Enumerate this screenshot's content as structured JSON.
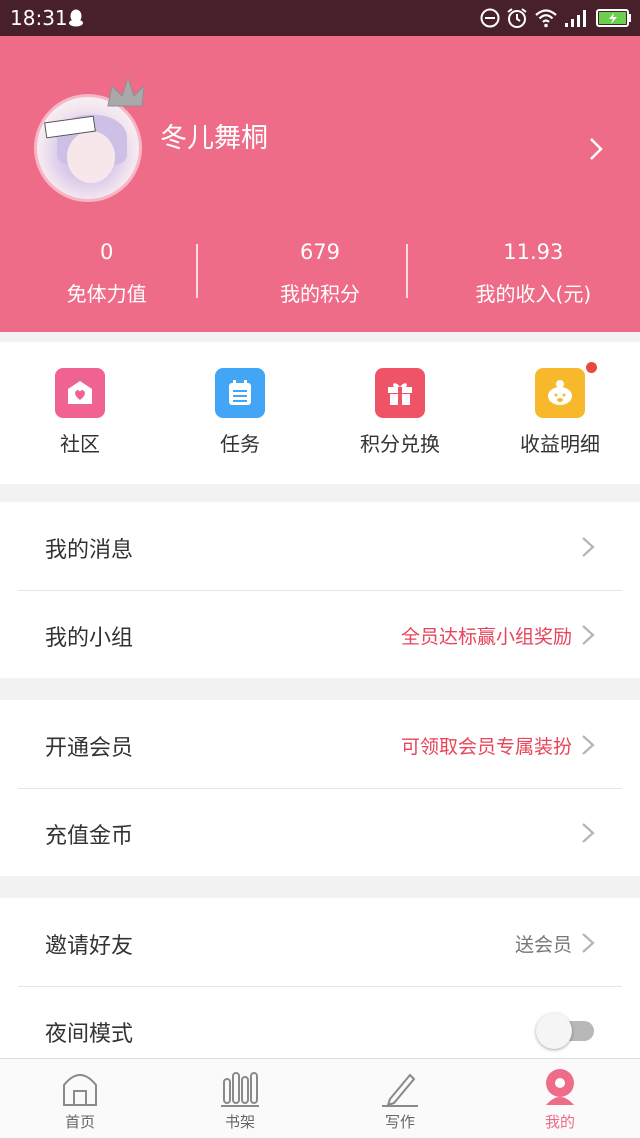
{
  "status_bar": {
    "time": "18:31"
  },
  "profile": {
    "username": "冬儿舞桐",
    "stats": [
      {
        "value": "0",
        "label": "免体力值"
      },
      {
        "value": "679",
        "label": "我的积分"
      },
      {
        "value": "11.93",
        "label": "我的收入(元)"
      }
    ]
  },
  "quick_actions": [
    {
      "label": "社区",
      "icon": "community-icon",
      "color": "#f06292"
    },
    {
      "label": "任务",
      "icon": "task-icon",
      "color": "#42a5f5"
    },
    {
      "label": "积分兑换",
      "icon": "gift-icon",
      "color": "#ef5366"
    },
    {
      "label": "收益明细",
      "icon": "piggy-icon",
      "color": "#f7b92b"
    }
  ],
  "menu": {
    "messages": {
      "title": "我的消息",
      "sub": ""
    },
    "groups": {
      "title": "我的小组",
      "sub": "全员达标赢小组奖励"
    },
    "vip": {
      "title": "开通会员",
      "sub": "可领取会员专属装扮"
    },
    "recharge": {
      "title": "充值金币",
      "sub": ""
    },
    "invite": {
      "title": "邀请好友",
      "sub": "送会员"
    },
    "night_mode": {
      "title": "夜间模式",
      "enabled": false
    }
  },
  "bottom_nav": [
    {
      "label": "首页",
      "icon": "home-icon"
    },
    {
      "label": "书架",
      "icon": "bookshelf-icon"
    },
    {
      "label": "写作",
      "icon": "pen-icon"
    },
    {
      "label": "我的",
      "icon": "profile-icon",
      "active": true
    }
  ],
  "colors": {
    "accent": "#ee6c88",
    "highlight_text": "#e8445a",
    "status_bar": "#47202a"
  }
}
